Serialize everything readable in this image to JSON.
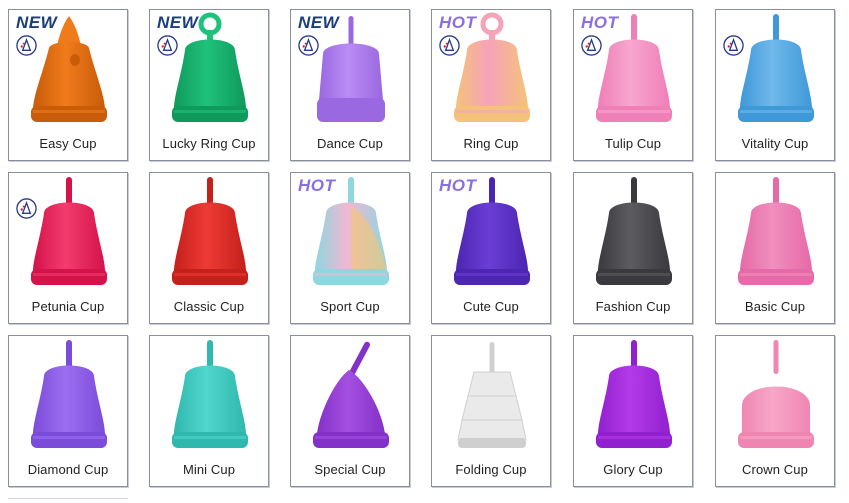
{
  "products": [
    {
      "name": "Easy Cup",
      "badge": "NEW",
      "logo": true,
      "color": "#f07b1c",
      "accent": "#c85c08",
      "shape": "easy"
    },
    {
      "name": "Lucky Ring Cup",
      "badge": "NEW",
      "logo": true,
      "color": "#1fc17b",
      "accent": "#0f9a5c",
      "shape": "ring"
    },
    {
      "name": "Dance Cup",
      "badge": "NEW",
      "logo": true,
      "color": "#b98cf3",
      "accent": "#9a68e0",
      "shape": "dance"
    },
    {
      "name": "Ring Cup",
      "badge": "HOT",
      "logo": true,
      "color": "#f6a3b8",
      "accent": "#f4c27a",
      "shape": "ring"
    },
    {
      "name": "Tulip Cup",
      "badge": "HOT",
      "logo": true,
      "color": "#f7a6cf",
      "accent": "#ef7fb7",
      "shape": "tulip"
    },
    {
      "name": "Vitality Cup",
      "badge": "",
      "logo": true,
      "color": "#6fb9ea",
      "accent": "#3f98d8",
      "shape": "tulip"
    },
    {
      "name": "Petunia Cup",
      "badge": "",
      "logo": true,
      "color": "#f43b6e",
      "accent": "#d3134a",
      "shape": "petunia"
    },
    {
      "name": "Classic Cup",
      "badge": "",
      "logo": false,
      "color": "#ee3a34",
      "accent": "#c4201c",
      "shape": "classic"
    },
    {
      "name": "Sport Cup",
      "badge": "HOT",
      "logo": false,
      "color": "#f2b7d2",
      "accent": "#8fd6e0",
      "shape": "sport"
    },
    {
      "name": "Cute Cup",
      "badge": "HOT",
      "logo": false,
      "color": "#6a3ed6",
      "accent": "#4c25b0",
      "shape": "classic"
    },
    {
      "name": "Fashion Cup",
      "badge": "",
      "logo": false,
      "color": "#5c5c60",
      "accent": "#3a3a3e",
      "shape": "classic"
    },
    {
      "name": "Basic Cup",
      "badge": "",
      "logo": false,
      "color": "#f08fbe",
      "accent": "#e56aa7",
      "shape": "classic"
    },
    {
      "name": "Diamond Cup",
      "badge": "",
      "logo": false,
      "color": "#9b6ef0",
      "accent": "#7b4cd9",
      "shape": "tulip"
    },
    {
      "name": "Mini Cup",
      "badge": "",
      "logo": false,
      "color": "#52d6cc",
      "accent": "#2fb8ad",
      "shape": "classic"
    },
    {
      "name": "Special Cup",
      "badge": "",
      "logo": false,
      "color": "#a44fe0",
      "accent": "#8331c8",
      "shape": "special"
    },
    {
      "name": "Folding Cup",
      "badge": "",
      "logo": false,
      "color": "#eaeaea",
      "accent": "#cfcfcf",
      "shape": "folding"
    },
    {
      "name": "Glory Cup",
      "badge": "",
      "logo": false,
      "color": "#b53ae8",
      "accent": "#9120cf",
      "shape": "tulip"
    },
    {
      "name": "Crown Cup",
      "badge": "",
      "logo": false,
      "color": "#f8a7c8",
      "accent": "#ef86b2",
      "shape": "crown"
    }
  ],
  "colors": {
    "new_badge": "#1b3f7a",
    "hot_badge": "#8a6fe0"
  }
}
